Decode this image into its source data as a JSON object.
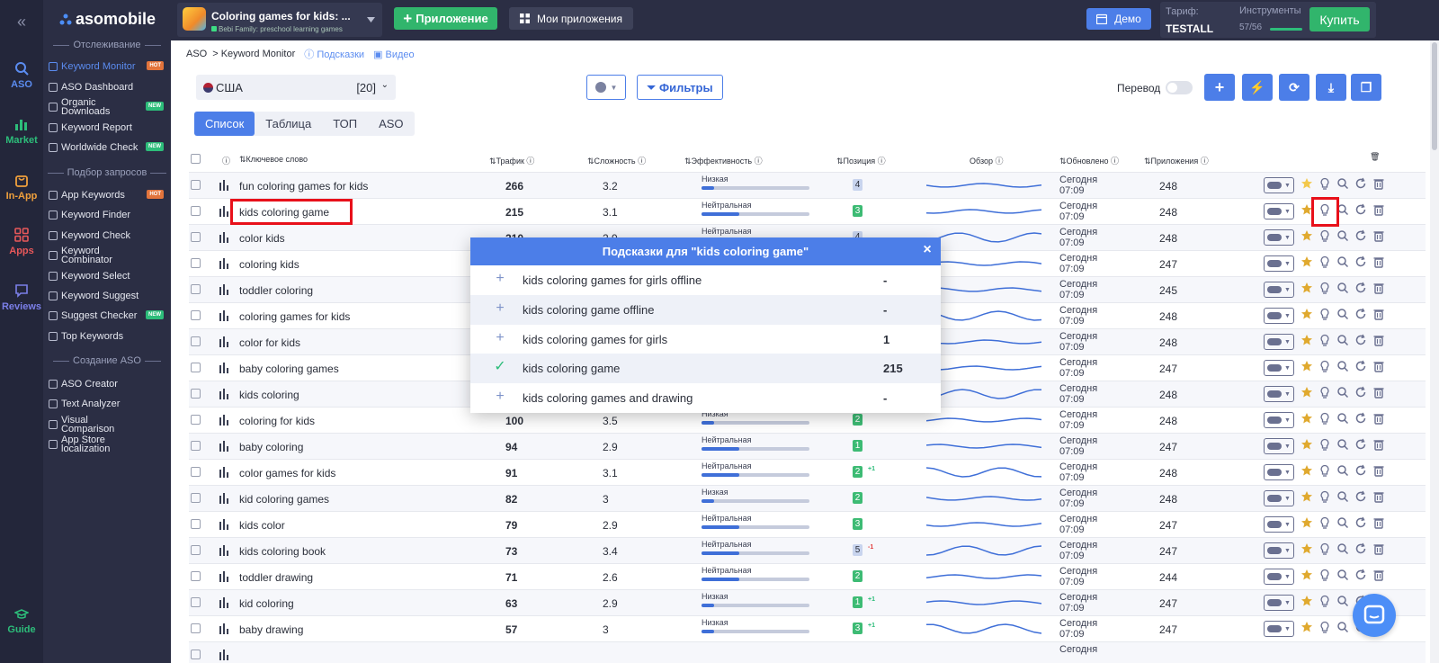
{
  "rail": {
    "collapse_glyph": "«",
    "items": [
      {
        "label": "ASO",
        "icon": "search-icon",
        "color": "#5b8cf0"
      },
      {
        "label": "Market",
        "icon": "chart-icon",
        "color": "#2dbd7a"
      },
      {
        "label": "In-App",
        "icon": "bag-icon",
        "color": "#f0a03c"
      },
      {
        "label": "Apps",
        "icon": "grid-icon",
        "color": "#e8585a"
      },
      {
        "label": "Reviews",
        "icon": "chat-icon",
        "color": "#7b7fe8"
      }
    ],
    "guide": "Guide"
  },
  "sidebar": {
    "logo": "asomobile",
    "sections": {
      "tracking": "Отслеживание",
      "query": "Подбор запросов",
      "creation": "Создание ASO"
    },
    "tracking_items": [
      {
        "label": "Keyword Monitor",
        "badge": "HOT"
      },
      {
        "label": "ASO Dashboard",
        "badge": ""
      },
      {
        "label": "Organic Downloads",
        "badge": "NEW"
      },
      {
        "label": "Keyword Report",
        "badge": ""
      },
      {
        "label": "Worldwide Check",
        "badge": "NEW"
      }
    ],
    "query_items": [
      {
        "label": "App Keywords",
        "badge": "HOT"
      },
      {
        "label": "Keyword Finder",
        "badge": ""
      },
      {
        "label": "Keyword Check",
        "badge": ""
      },
      {
        "label": "Keyword Combinator",
        "badge": ""
      },
      {
        "label": "Keyword Select",
        "badge": ""
      },
      {
        "label": "Keyword Suggest",
        "badge": ""
      },
      {
        "label": "Suggest Checker",
        "badge": "NEW"
      },
      {
        "label": "Top Keywords",
        "badge": ""
      }
    ],
    "creation_items": [
      {
        "label": "ASO Creator"
      },
      {
        "label": "Text Analyzer"
      },
      {
        "label": "Visual Comparison"
      },
      {
        "label": "App Store localization"
      }
    ]
  },
  "topbar": {
    "app_title": "Coloring games for kids: ...",
    "app_subtitle": "Bebi Family: preschool learning games",
    "add_app": "Приложение",
    "my_apps": "Мои приложения",
    "demo": "Демо",
    "tariff_label": "Тариф:",
    "tariff_value": "TESTALL",
    "tools_label": "Инструменты",
    "tools_value": "57/56",
    "buy": "Купить"
  },
  "breadcrumb": {
    "root": "ASO",
    "current": "> Keyword Monitor",
    "hints": "Подсказки",
    "video": "Видео"
  },
  "filters": {
    "country": "США",
    "country_count": "[20]",
    "filters_label": "Фильтры",
    "translate_label": "Перевод"
  },
  "tabs": [
    "Список",
    "Таблица",
    "ТОП",
    "ASO"
  ],
  "table": {
    "headers": {
      "keyword": "Ключевое слово",
      "traffic": "Трафик",
      "difficulty": "Сложность",
      "efficiency": "Эффективность",
      "position": "Позиция",
      "overview": "Обзор",
      "updated": "Обновлено",
      "apps": "Приложения"
    },
    "rows": [
      {
        "kw": "fun coloring games for kids",
        "traffic": "266",
        "diff": "3.2",
        "eff": "Низкая",
        "eff_level": 0.12,
        "pos": "4",
        "pos_type": "n",
        "delta": "",
        "upd1": "Сегодня",
        "upd2": "07:09",
        "apps": "248"
      },
      {
        "kw": "kids coloring game",
        "traffic": "215",
        "diff": "3.1",
        "eff": "Нейтральная",
        "eff_level": 0.35,
        "pos": "3",
        "pos_type": "g",
        "delta": "",
        "upd1": "Сегодня",
        "upd2": "07:09",
        "apps": "248"
      },
      {
        "kw": "color kids",
        "traffic": "210",
        "diff": "2.9",
        "eff": "Нейтральная",
        "eff_level": 0.35,
        "pos": "4",
        "pos_type": "n",
        "delta": "",
        "upd1": "Сегодня",
        "upd2": "07:09",
        "apps": "248"
      },
      {
        "kw": "coloring kids",
        "traffic": "",
        "diff": "",
        "eff": "",
        "eff_level": 0,
        "pos": "",
        "pos_type": "",
        "delta": "",
        "upd1": "Сегодня",
        "upd2": "07:09",
        "apps": "247"
      },
      {
        "kw": "toddler coloring",
        "traffic": "",
        "diff": "",
        "eff": "",
        "eff_level": 0,
        "pos": "",
        "pos_type": "",
        "delta": "",
        "upd1": "Сегодня",
        "upd2": "07:09",
        "apps": "245"
      },
      {
        "kw": "coloring games for kids",
        "traffic": "",
        "diff": "",
        "eff": "",
        "eff_level": 0,
        "pos": "",
        "pos_type": "",
        "delta": "",
        "upd1": "Сегодня",
        "upd2": "07:09",
        "apps": "248"
      },
      {
        "kw": "color for kids",
        "traffic": "",
        "diff": "",
        "eff": "",
        "eff_level": 0,
        "pos": "",
        "pos_type": "",
        "delta": "",
        "upd1": "Сегодня",
        "upd2": "07:09",
        "apps": "248"
      },
      {
        "kw": "baby coloring games",
        "traffic": "",
        "diff": "",
        "eff": "",
        "eff_level": 0,
        "pos": "",
        "pos_type": "",
        "delta": "",
        "upd1": "Сегодня",
        "upd2": "07:09",
        "apps": "247"
      },
      {
        "kw": "kids coloring",
        "traffic": "",
        "diff": "",
        "eff": "",
        "eff_level": 0,
        "pos": "",
        "pos_type": "",
        "delta": "",
        "upd1": "Сегодня",
        "upd2": "07:09",
        "apps": "248"
      },
      {
        "kw": "coloring for kids",
        "traffic": "100",
        "diff": "3.5",
        "eff": "Низкая",
        "eff_level": 0.12,
        "pos": "2",
        "pos_type": "g",
        "delta": "",
        "upd1": "Сегодня",
        "upd2": "07:09",
        "apps": "248"
      },
      {
        "kw": "baby coloring",
        "traffic": "94",
        "diff": "2.9",
        "eff": "Нейтральная",
        "eff_level": 0.35,
        "pos": "1",
        "pos_type": "g",
        "delta": "",
        "upd1": "Сегодня",
        "upd2": "07:09",
        "apps": "247"
      },
      {
        "kw": "color games for kids",
        "traffic": "91",
        "diff": "3.1",
        "eff": "Нейтральная",
        "eff_level": 0.35,
        "pos": "2",
        "pos_type": "g",
        "delta": "+1",
        "upd1": "Сегодня",
        "upd2": "07:09",
        "apps": "248"
      },
      {
        "kw": "kid coloring games",
        "traffic": "82",
        "diff": "3",
        "eff": "Низкая",
        "eff_level": 0.12,
        "pos": "2",
        "pos_type": "g",
        "delta": "",
        "upd1": "Сегодня",
        "upd2": "07:09",
        "apps": "248"
      },
      {
        "kw": "kids color",
        "traffic": "79",
        "diff": "2.9",
        "eff": "Нейтральная",
        "eff_level": 0.35,
        "pos": "3",
        "pos_type": "g",
        "delta": "",
        "upd1": "Сегодня",
        "upd2": "07:09",
        "apps": "247"
      },
      {
        "kw": "kids coloring book",
        "traffic": "73",
        "diff": "3.4",
        "eff": "Нейтральная",
        "eff_level": 0.35,
        "pos": "5",
        "pos_type": "n",
        "delta": "-1",
        "upd1": "Сегодня",
        "upd2": "07:09",
        "apps": "247"
      },
      {
        "kw": "toddler drawing",
        "traffic": "71",
        "diff": "2.6",
        "eff": "Нейтральная",
        "eff_level": 0.35,
        "pos": "2",
        "pos_type": "g",
        "delta": "",
        "upd1": "Сегодня",
        "upd2": "07:09",
        "apps": "244"
      },
      {
        "kw": "kid coloring",
        "traffic": "63",
        "diff": "2.9",
        "eff": "Низкая",
        "eff_level": 0.12,
        "pos": "1",
        "pos_type": "g",
        "delta": "+1",
        "upd1": "Сегодня",
        "upd2": "07:09",
        "apps": "247"
      },
      {
        "kw": "baby drawing",
        "traffic": "57",
        "diff": "3",
        "eff": "Низкая",
        "eff_level": 0.12,
        "pos": "3",
        "pos_type": "g",
        "delta": "+1",
        "upd1": "Сегодня",
        "upd2": "07:09",
        "apps": "247"
      },
      {
        "kw": "",
        "traffic": "",
        "diff": "",
        "eff": "",
        "eff_level": 0,
        "pos": "",
        "pos_type": "",
        "delta": "",
        "upd1": "Сегодня",
        "upd2": "",
        "apps": ""
      }
    ]
  },
  "modal": {
    "title": "Подсказки для \"kids coloring game\"",
    "close": "×",
    "items": [
      {
        "text": "kids coloring games for girls offline",
        "value": "-",
        "added": false
      },
      {
        "text": "kids coloring game offline",
        "value": "-",
        "added": false
      },
      {
        "text": "kids coloring games for girls",
        "value": "1",
        "added": false
      },
      {
        "text": "kids coloring game",
        "value": "215",
        "added": true
      },
      {
        "text": "kids coloring games and drawing",
        "value": "-",
        "added": false
      }
    ]
  },
  "colors": {
    "accent": "#4c7ee8",
    "green": "#31b56c",
    "sidebar_bg": "#2b2e44",
    "highlight": "#e8101a"
  }
}
